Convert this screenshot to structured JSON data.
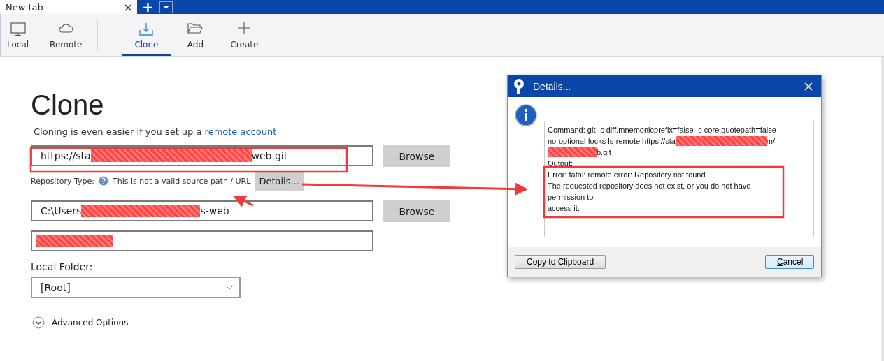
{
  "tab": {
    "title": "New tab",
    "close": "×",
    "add": "+"
  },
  "toolbar": {
    "left": [
      {
        "label": "Local",
        "selected": false
      },
      {
        "label": "Remote",
        "selected": false
      }
    ],
    "right": [
      {
        "label": "Clone",
        "selected": true
      },
      {
        "label": "Add",
        "selected": false
      },
      {
        "label": "Create",
        "selected": false
      }
    ]
  },
  "clone": {
    "title": "Clone",
    "subtitle": "Cloning is even easier if you set up a",
    "subtitle_link": "remote account",
    "url": {
      "prefix": "https://sta",
      "suffix": "web.git"
    },
    "browse": "Browse",
    "repo_type_label": "Repository Type:",
    "repo_type_status": "This is not a valid source path / URL",
    "details": "Details...",
    "path": {
      "prefix": "C:\\Users",
      "suffix": "s-web"
    },
    "browse_2": "Browse",
    "local_folder_label": "Local Folder:",
    "local_folder": "[Root]",
    "advanced": "Advanced Options"
  },
  "dialog": {
    "title": "Details...",
    "command_1": "Command: git -c diff.mnemonicprefix=false -c core.quotepath=false --",
    "command_2": "no-optional-locks ls-remote https://sta",
    "command_2_end": "m/",
    "command_3_end": "b.git",
    "output_label": "Output:",
    "error_lines": [
      "Error: fatal: remote error: Repository not found",
      "The requested repository does not exist, or you do not have",
      "permission to",
      "access it."
    ],
    "copy": "Copy to Clipboard",
    "cancel": "Cancel"
  }
}
